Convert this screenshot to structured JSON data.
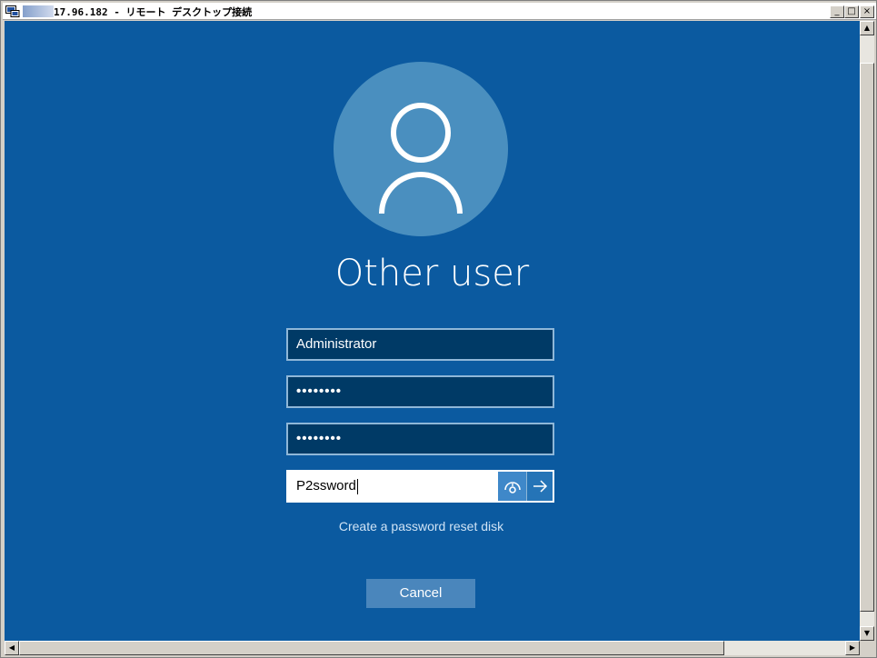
{
  "window": {
    "title": "17.96.182 - リモート デスクトップ接続",
    "controls": {
      "minimize": "_",
      "maximize": "□",
      "close": "×"
    }
  },
  "login": {
    "user_title": "Other user",
    "username_value": "Administrator",
    "password_masked": "••••••••",
    "password2_masked": "••••••••",
    "new_password_value": "P2ssword",
    "reset_link": "Create a password reset disk",
    "cancel_label": "Cancel"
  },
  "icons": {
    "avatar": "person-outline-icon",
    "reveal": "reveal-password-icon",
    "submit": "arrow-right-icon"
  },
  "colors": {
    "background": "#0b5aa0",
    "avatar_circle": "#4a8fbf",
    "field_bg": "#003a66",
    "field_border": "#8fb7d8",
    "cancel_bg": "#4a86bc"
  }
}
